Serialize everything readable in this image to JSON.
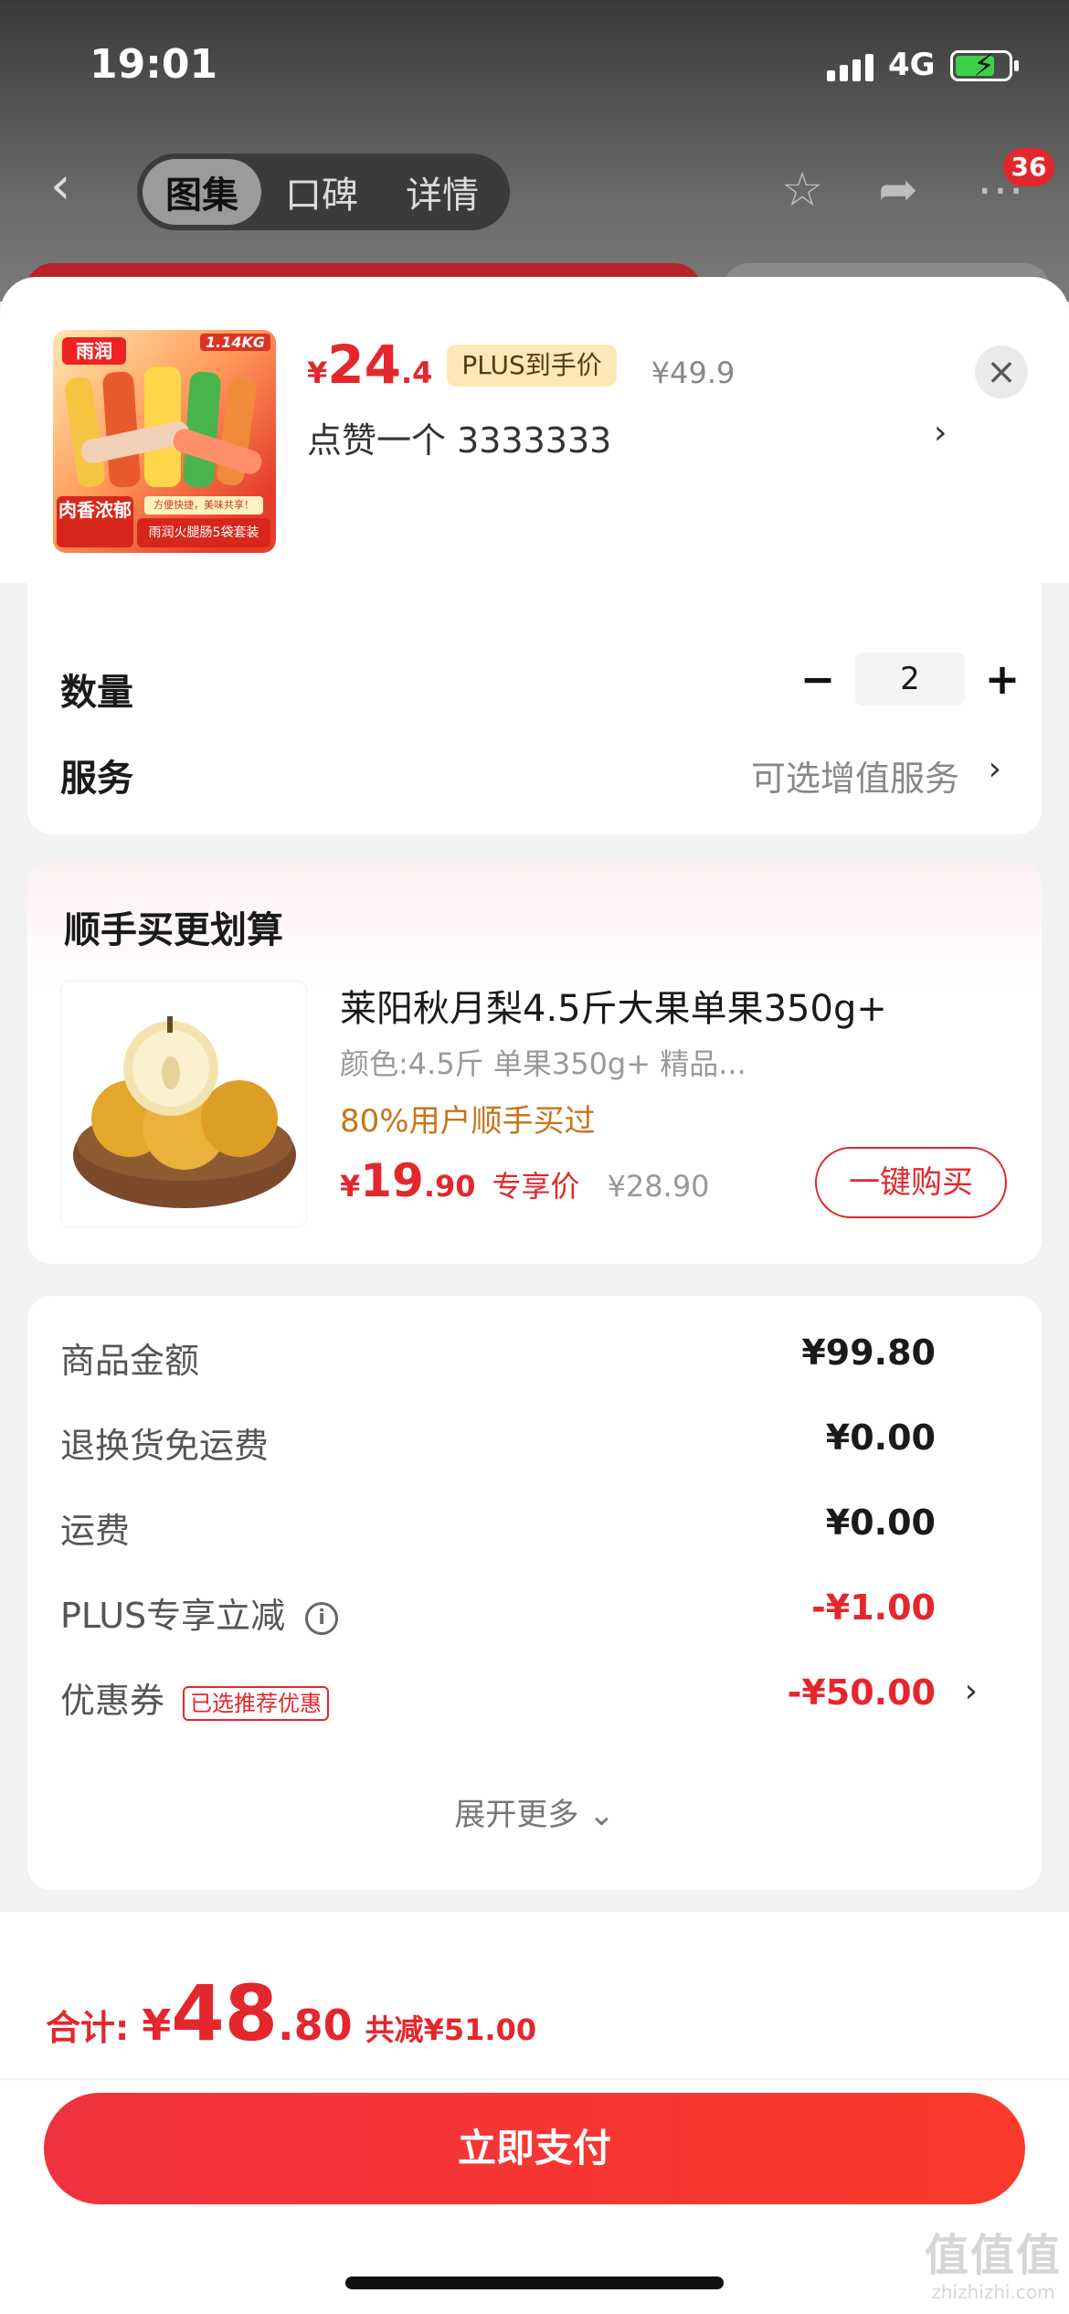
{
  "status_bar": {
    "time": "19:01",
    "network": "4G"
  },
  "nav": {
    "tabs": [
      "图集",
      "口碑",
      "详情"
    ],
    "active_tab": 0,
    "cart_badge": "36"
  },
  "sheet": {
    "product": {
      "price_yen": "¥",
      "price_int": "24",
      "price_dec": ".4",
      "plus_tag": "PLUS到手价",
      "original_price": "¥49.9",
      "spec": "点赞一个  3333333",
      "image_logo": "雨润",
      "image_weight": "1.14KG",
      "image_tag_main": "肉香浓郁",
      "image_tag_bottom": "雨润火腿肠5袋套装",
      "image_tag_slogan": "方便快捷，美味共享！"
    },
    "quantity": {
      "label": "数量",
      "minus": "−",
      "value": "2",
      "plus": "+"
    },
    "service": {
      "label": "服务",
      "value": "可选增值服务"
    }
  },
  "combo": {
    "title": "顺手买更划算",
    "name": "莱阳秋月梨4.5斤大果单果350g+",
    "spec": "颜色:4.5斤 单果350g+ 精品...",
    "hint": "80%用户顺手买过",
    "price_yen": "¥",
    "price_int": "19",
    "price_dec": ".90",
    "price_label": "专享价",
    "original_price": "¥28.90",
    "buy_label": "一键购买"
  },
  "summary": {
    "rows": [
      {
        "label": "商品金额",
        "value": "¥99.80"
      },
      {
        "label": "退换货免运费",
        "value": "¥0.00"
      },
      {
        "label": "运费",
        "value": "¥0.00"
      },
      {
        "label": "PLUS专享立减",
        "value": "-¥1.00"
      },
      {
        "label": "优惠券",
        "value": "-¥50.00",
        "tag": "已选推荐优惠"
      }
    ],
    "expand_label": "展开更多 ⌄"
  },
  "footer": {
    "total_label": "合计:",
    "total_yen": "¥",
    "total_int": "48",
    "total_dec": ".80",
    "savings": "共减¥51.00",
    "pay_label": "立即支付"
  },
  "watermark": {
    "logo": "值值值",
    "domain": "zhizhizhi.com"
  },
  "colors": {
    "accent": "#e4262d",
    "plus_tag_bg": "#fbe7b8",
    "hint": "#c8741a"
  }
}
